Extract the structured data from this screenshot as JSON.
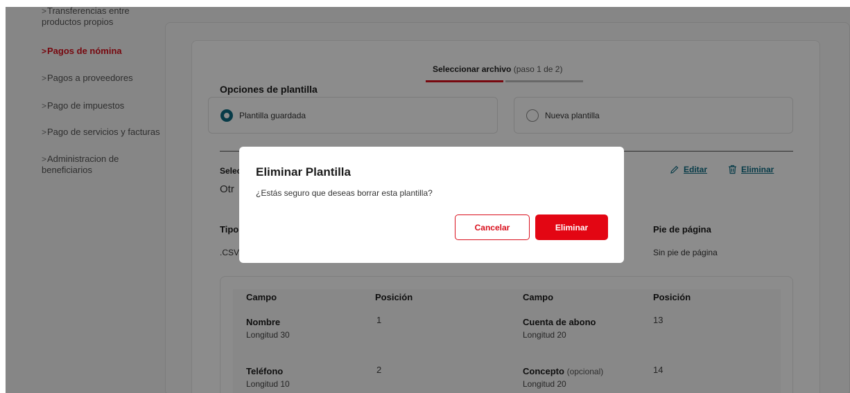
{
  "sidebar": {
    "items": [
      {
        "label": "Transferencias entre productos propios",
        "active": false
      },
      {
        "label": "Pagos de nómina",
        "active": true
      },
      {
        "label": "Pagos a proveedores",
        "active": false
      },
      {
        "label": "Pago de impuestos",
        "active": false
      },
      {
        "label": "Pago de servicios y facturas",
        "active": false
      },
      {
        "label": "Administracion de beneficiarios",
        "active": false
      }
    ],
    "line1": "Transferencias entre",
    "line1b": "productos propios",
    "line6": "Administracion de",
    "line6b": "beneficiarios"
  },
  "stepper": {
    "title": "Seleccionar archivo",
    "step": "(paso 1 de 2)"
  },
  "template_options": {
    "title": "Opciones de plantilla",
    "saved": "Plantilla guardada",
    "new": "Nueva plantilla",
    "selected": "saved"
  },
  "selected_template": {
    "label": "Selec",
    "value": "Otr",
    "edit": "Editar",
    "delete": "Eliminar"
  },
  "file_info": {
    "type_label": "Tipo",
    "type_value": ".CSV",
    "footer_label": "Pie de página",
    "footer_value": "Sin pie de página"
  },
  "fields": {
    "headers": [
      "Campo",
      "Posición",
      "Campo",
      "Posición"
    ],
    "rows": [
      {
        "name": "Nombre",
        "length": "Longitud 30",
        "position": "1",
        "name2": "Cuenta de abono",
        "optional2": "",
        "length2": "Longitud 20",
        "position2": "13"
      },
      {
        "name": "Teléfono",
        "length": "Longitud 10",
        "position": "2",
        "name2": "Concepto",
        "optional2": "(opcional)",
        "length2": "Longitud 20",
        "position2": "14"
      }
    ]
  },
  "modal": {
    "title": "Eliminar Plantilla",
    "message": "¿Estás seguro que deseas borrar esta plantilla?",
    "cancel": "Cancelar",
    "confirm": "Eliminar"
  },
  "colors": {
    "brand_red": "#e30613",
    "accent_teal": "#0e6c84"
  }
}
